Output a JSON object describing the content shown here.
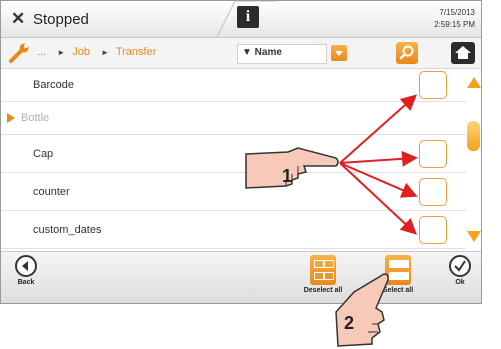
{
  "header": {
    "close_glyph": "✕",
    "status": "Stopped",
    "info_glyph": "i",
    "date": "7/15/2013",
    "time": "2:59:15 PM"
  },
  "breadcrumb": {
    "ellipsis": "...",
    "items": [
      "Job",
      "Transfer"
    ]
  },
  "sort": {
    "label": "▼ Name"
  },
  "list": {
    "items": [
      {
        "label": "Barcode",
        "type": "item"
      },
      {
        "label": "Bottle",
        "type": "parent"
      },
      {
        "label": "Cap",
        "type": "item"
      },
      {
        "label": "counter",
        "type": "item"
      },
      {
        "label": "custom_dates",
        "type": "item"
      }
    ]
  },
  "toolbar": {
    "back_label": "Back",
    "deselect_label": "Deselect all",
    "select_label": "Select all",
    "ok_label": "Ok"
  },
  "callouts": {
    "one": "1",
    "two": "2"
  },
  "colors": {
    "accent": "#e8891a",
    "arrow": "#e02020"
  }
}
